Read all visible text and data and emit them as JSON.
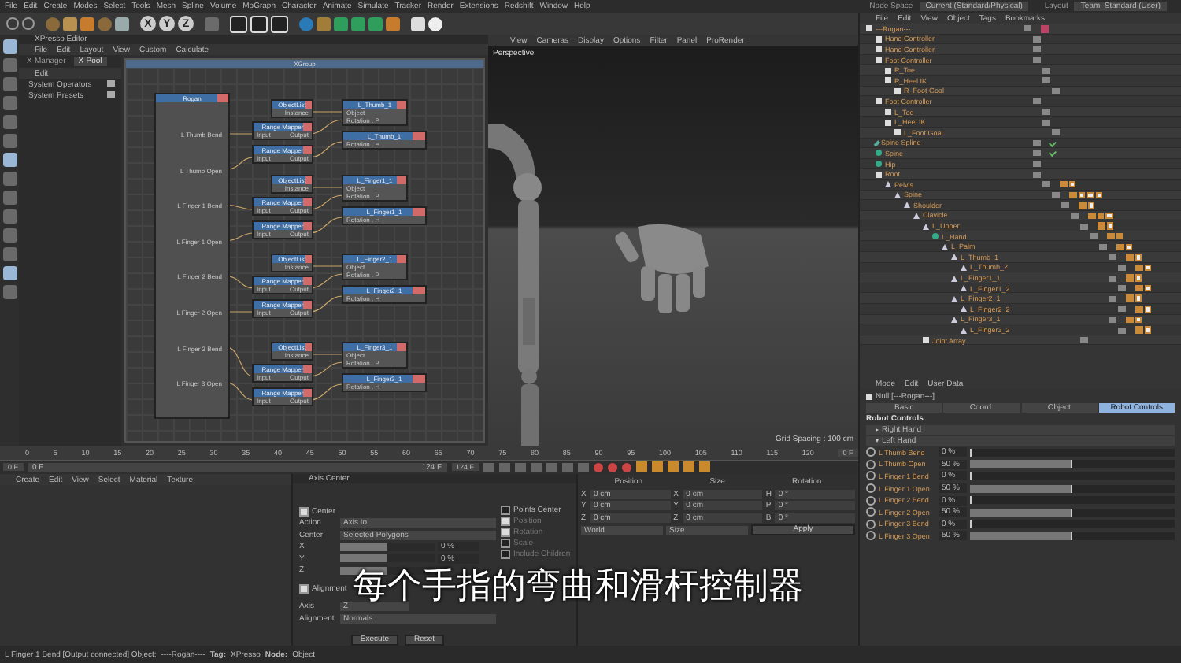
{
  "menu_bar": {
    "items": [
      "File",
      "Edit",
      "Create",
      "Modes",
      "Select",
      "Tools",
      "Mesh",
      "Spline",
      "Volume",
      "MoGraph",
      "Character",
      "Animate",
      "Simulate",
      "Tracker",
      "Render",
      "Extensions",
      "Redshift",
      "Window",
      "Help"
    ],
    "node_space_label": "Node Space",
    "node_space": "Current (Standard/Physical)",
    "layout_label": "Layout",
    "layout": "Team_Standard (User)"
  },
  "toolbar": {
    "axis_buttons": [
      "X",
      "Y",
      "Z"
    ]
  },
  "xpresso": {
    "title": "XPresso Editor",
    "menu": [
      "File",
      "Edit",
      "Layout",
      "View",
      "Custom",
      "Calculate"
    ],
    "tabs": [
      {
        "label": "X-Manager",
        "selected": false
      },
      {
        "label": "X-Pool",
        "selected": true
      }
    ],
    "pool_menu": "Edit",
    "pool_items": [
      "System Operators",
      "System Presets"
    ],
    "group_title": "XGroup",
    "source": {
      "title": "Rogan",
      "ports": [
        "L Thumb Bend",
        "L Thumb Open",
        "L Finger 1 Bend",
        "L Finger 1 Open",
        "L Finger 2 Bend",
        "L Finger 2 Open",
        "L Finger 3 Bend",
        "L Finger 3 Open"
      ]
    },
    "groups": [
      {
        "list": {
          "title": "ObjectList",
          "port": "Instance"
        },
        "mappers": [
          {
            "title": "Range Mapper",
            "input": "Input",
            "output": "Output"
          },
          {
            "title": "Range Mapper",
            "input": "Input",
            "output": "Output"
          }
        ],
        "targets": [
          {
            "title": "L_Thumb_1",
            "ports": [
              "Object",
              "Rotation . P"
            ]
          },
          {
            "title": "L_Thumb_1",
            "ports": [
              "Rotation . H"
            ]
          }
        ]
      },
      {
        "list": {
          "title": "ObjectList",
          "port": "Instance"
        },
        "mappers": [
          {
            "title": "Range Mapper",
            "input": "Input",
            "output": "Output"
          },
          {
            "title": "Range Mapper",
            "input": "Input",
            "output": "Output"
          }
        ],
        "targets": [
          {
            "title": "L_Finger1_1",
            "ports": [
              "Object",
              "Rotation . P"
            ]
          },
          {
            "title": "L_Finger1_1",
            "ports": [
              "Rotation . H"
            ]
          }
        ]
      },
      {
        "list": {
          "title": "ObjectList",
          "port": "Instance"
        },
        "mappers": [
          {
            "title": "Range Mapper",
            "input": "Input",
            "output": "Output"
          },
          {
            "title": "Range Mapper",
            "input": "Input",
            "output": "Output"
          }
        ],
        "targets": [
          {
            "title": "L_Finger2_1",
            "ports": [
              "Object",
              "Rotation . P"
            ]
          },
          {
            "title": "L_Finger2_1",
            "ports": [
              "Rotation . H"
            ]
          }
        ]
      },
      {
        "list": {
          "title": "ObjectList",
          "port": "Instance"
        },
        "mappers": [
          {
            "title": "Range Mapper",
            "input": "Input",
            "output": "Output"
          },
          {
            "title": "Range Mapper",
            "input": "Input",
            "output": "Output"
          }
        ],
        "targets": [
          {
            "title": "L_Finger3_1",
            "ports": [
              "Object",
              "Rotation . P"
            ]
          },
          {
            "title": "L_Finger3_1",
            "ports": [
              "Rotation . H"
            ]
          }
        ]
      }
    ]
  },
  "viewport": {
    "menu": [
      "View",
      "Cameras",
      "Display",
      "Options",
      "Filter",
      "Panel",
      "ProRender"
    ],
    "camera": "Perspective",
    "grid_spacing": "Grid Spacing : 100 cm"
  },
  "object_manager": {
    "menu": [
      "File",
      "Edit",
      "View",
      "Object",
      "Tags",
      "Bookmarks"
    ],
    "objects": [
      {
        "name": "---Rogan---",
        "kind": "null",
        "tags": [
          {
            "kind": "xpresso"
          }
        ],
        "children": [
          {
            "name": "Hand Controller",
            "kind": "null"
          },
          {
            "name": "Hand Controller",
            "kind": "null"
          },
          {
            "name": "Foot Controller",
            "kind": "null",
            "children": [
              {
                "name": "R_Toe",
                "kind": "null"
              },
              {
                "name": "R_Heel IK",
                "kind": "null",
                "children": [
                  {
                    "name": "R_Foot Goal",
                    "kind": "null"
                  }
                ]
              }
            ]
          },
          {
            "name": "Foot Controller",
            "kind": "null",
            "children": [
              {
                "name": "L_Toe",
                "kind": "null"
              },
              {
                "name": "L_Heel IK",
                "kind": "null",
                "children": [
                  {
                    "name": "L_Foot Goal",
                    "kind": "null"
                  }
                ]
              }
            ]
          },
          {
            "name": "Spine Spline",
            "kind": "spline",
            "tags": [
              {
                "kind": "check"
              }
            ]
          },
          {
            "name": "Spine",
            "kind": "sphere",
            "tags": [
              {
                "kind": "check"
              }
            ]
          },
          {
            "name": "Hip",
            "kind": "sphere"
          },
          {
            "name": "Root",
            "kind": "null",
            "children": [
              {
                "name": "Pelvis",
                "kind": "joint",
                "tags": [
                  {
                    "kind": "ik"
                  },
                  {
                    "kind": "weight"
                  }
                ],
                "children": [
                  {
                    "name": "Spine",
                    "kind": "joint",
                    "tags": [
                      {
                        "kind": "ik"
                      },
                      {
                        "kind": "weight"
                      },
                      {
                        "kind": "weight"
                      },
                      {
                        "kind": "weight"
                      }
                    ],
                    "children": [
                      {
                        "name": "Shoulder",
                        "kind": "joint",
                        "tags": [
                          {
                            "kind": "ik"
                          },
                          {
                            "kind": "weight"
                          }
                        ],
                        "children": [
                          {
                            "name": "Clavicle",
                            "kind": "joint",
                            "tags": [
                              {
                                "kind": "ik"
                              },
                              {
                                "kind": "ik"
                              },
                              {
                                "kind": "weight"
                              }
                            ],
                            "children": [
                              {
                                "name": "L_Upper",
                                "kind": "joint",
                                "tags": [
                                  {
                                    "kind": "ik"
                                  },
                                  {
                                    "kind": "weight"
                                  }
                                ],
                                "children": [
                                  {
                                    "name": "L_Hand",
                                    "kind": "sphere",
                                    "tags": [
                                      {
                                        "kind": "ik"
                                      },
                                      {
                                        "kind": "ik"
                                      }
                                    ],
                                    "children": [
                                      {
                                        "name": "L_Palm",
                                        "kind": "joint",
                                        "tags": [
                                          {
                                            "kind": "ik"
                                          },
                                          {
                                            "kind": "weight"
                                          }
                                        ],
                                        "children": [
                                          {
                                            "name": "L_Thumb_1",
                                            "kind": "joint",
                                            "tags": [
                                              {
                                                "kind": "ik"
                                              },
                                              {
                                                "kind": "weight"
                                              }
                                            ],
                                            "children": [
                                              {
                                                "name": "L_Thumb_2",
                                                "kind": "joint",
                                                "tags": [
                                                  {
                                                    "kind": "ik"
                                                  },
                                                  {
                                                    "kind": "weight"
                                                  }
                                                ]
                                              }
                                            ]
                                          },
                                          {
                                            "name": "L_Finger1_1",
                                            "kind": "joint",
                                            "tags": [
                                              {
                                                "kind": "ik"
                                              },
                                              {
                                                "kind": "weight"
                                              }
                                            ],
                                            "children": [
                                              {
                                                "name": "L_Finger1_2",
                                                "kind": "joint",
                                                "tags": [
                                                  {
                                                    "kind": "ik"
                                                  },
                                                  {
                                                    "kind": "weight"
                                                  }
                                                ]
                                              }
                                            ]
                                          },
                                          {
                                            "name": "L_Finger2_1",
                                            "kind": "joint",
                                            "tags": [
                                              {
                                                "kind": "ik"
                                              },
                                              {
                                                "kind": "weight"
                                              }
                                            ],
                                            "children": [
                                              {
                                                "name": "L_Finger2_2",
                                                "kind": "joint",
                                                "tags": [
                                                  {
                                                    "kind": "ik"
                                                  },
                                                  {
                                                    "kind": "weight"
                                                  }
                                                ]
                                              }
                                            ]
                                          },
                                          {
                                            "name": "L_Finger3_1",
                                            "kind": "joint",
                                            "tags": [
                                              {
                                                "kind": "ik"
                                              },
                                              {
                                                "kind": "weight"
                                              }
                                            ],
                                            "children": [
                                              {
                                                "name": "L_Finger3_2",
                                                "kind": "joint",
                                                "tags": [
                                                  {
                                                    "kind": "ik"
                                                  },
                                                  {
                                                    "kind": "weight"
                                                  }
                                                ]
                                              }
                                            ]
                                          }
                                        ]
                                      }
                                    ]
                                  }
                                ]
                              },
                              {
                                "name": "Joint Array",
                                "kind": "null"
                              }
                            ]
                          }
                        ]
                      }
                    ]
                  }
                ]
              }
            ]
          }
        ]
      }
    ]
  },
  "attributes": {
    "menu": [
      "Mode",
      "Edit",
      "User Data"
    ],
    "object_label": "Null [---Rogan---]",
    "tabs": [
      {
        "label": "Basic",
        "selected": false
      },
      {
        "label": "Coord.",
        "selected": false
      },
      {
        "label": "Object",
        "selected": false
      },
      {
        "label": "Robot Controls",
        "selected": true
      }
    ],
    "section": "Robot Controls",
    "groups": [
      {
        "label": "Right Hand",
        "expanded": false
      },
      {
        "label": "Left Hand",
        "expanded": true
      }
    ],
    "controls": [
      {
        "name": "L Thumb Bend",
        "value": "0 %",
        "level": 0
      },
      {
        "name": "L Thumb Open",
        "value": "50 %",
        "level": 0.5
      },
      {
        "name": "L Finger 1 Bend",
        "value": "0 %",
        "level": 0
      },
      {
        "name": "L Finger 1 Open",
        "value": "50 %",
        "level": 0.5
      },
      {
        "name": "L Finger 2 Bend",
        "value": "0 %",
        "level": 0
      },
      {
        "name": "L Finger 2 Open",
        "value": "50 %",
        "level": 0.5
      },
      {
        "name": "L Finger 3 Bend",
        "value": "0 %",
        "level": 0
      },
      {
        "name": "L Finger 3 Open",
        "value": "50 %",
        "level": 0.5
      }
    ]
  },
  "timeline": {
    "ticks": [
      "0",
      "5",
      "10",
      "15",
      "20",
      "25",
      "30",
      "35",
      "40",
      "45",
      "50",
      "55",
      "60",
      "65",
      "70",
      "75",
      "80",
      "85",
      "90",
      "95",
      "100",
      "105",
      "110",
      "115",
      "120"
    ],
    "current": "0 F",
    "start": "0 F",
    "range_start": "0 F",
    "range_end": "124 F",
    "end": "124 F"
  },
  "material_manager": {
    "menu": [
      "Create",
      "Edit",
      "View",
      "Select",
      "Material",
      "Texture"
    ]
  },
  "axis_center": {
    "title": "Axis Center",
    "center": {
      "label": "Center",
      "checked": true
    },
    "action_label": "Action",
    "action": "Axis to",
    "center_label": "Center",
    "center_value": "Selected Polygons",
    "sliders": [
      {
        "label": "X",
        "value": "0 %",
        "level": 0.5
      },
      {
        "label": "Y",
        "value": "0 %",
        "level": 0.5
      },
      {
        "label": "Z",
        "level": 0.5
      }
    ],
    "options": [
      {
        "label": "Points Center",
        "checked": false,
        "disabled": false
      },
      {
        "label": "Position",
        "checked": true,
        "disabled": true
      },
      {
        "label": "Rotation",
        "checked": true,
        "disabled": true
      },
      {
        "label": "Scale",
        "checked": false,
        "disabled": true
      },
      {
        "label": "Include Children",
        "checked": false,
        "disabled": true
      }
    ],
    "alignment_check": {
      "label": "Alignment",
      "checked": true
    },
    "axis_label": "Axis",
    "axis": "Z",
    "alignment_label": "Alignment",
    "alignment": "Normals",
    "buttons": [
      "Execute",
      "Reset"
    ]
  },
  "coordinates": {
    "headers": [
      "Position",
      "Size",
      "Rotation"
    ],
    "rows": [
      [
        "X",
        "0 cm",
        "X",
        "0 cm",
        "H",
        "0 °"
      ],
      [
        "Y",
        "0 cm",
        "Y",
        "0 cm",
        "P",
        "0 °"
      ],
      [
        "Z",
        "0 cm",
        "Z",
        "0 cm",
        "B",
        "0 °"
      ]
    ],
    "space": "World",
    "mode": "Size",
    "apply": "Apply"
  },
  "subtitle": "每个手指的弯曲和滑杆控制器",
  "status_bar": {
    "text": "L Finger 1 Bend [Output connected] Object:",
    "object": "----Rogan----",
    "tag_label": "Tag:",
    "tag": "XPresso",
    "node_label": "Node:",
    "node": "Object"
  }
}
